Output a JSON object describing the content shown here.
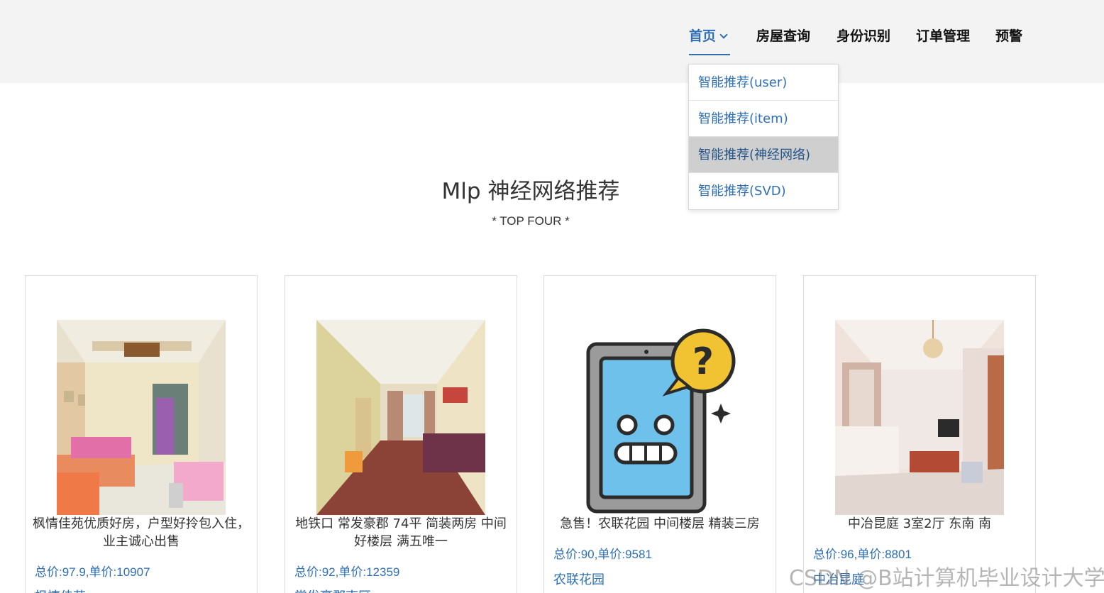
{
  "nav": {
    "items": [
      {
        "label": "首页",
        "active": true
      },
      {
        "label": "房屋查询"
      },
      {
        "label": "身份识别"
      },
      {
        "label": "订单管理"
      },
      {
        "label": "预警"
      }
    ],
    "dropdown": [
      {
        "label": "智能推荐(user)"
      },
      {
        "label": "智能推荐(item)"
      },
      {
        "label": "智能推荐(神经网络)",
        "hover": true
      },
      {
        "label": "智能推荐(SVD)"
      }
    ]
  },
  "section": {
    "title": "Mlp 神经网络推荐",
    "subtitle": "* TOP FOUR *"
  },
  "cards": [
    {
      "name": "枫情佳苑优质好房，户型好拎包入住，业主诚心出售",
      "price": "总价:97.9,单价:10907",
      "community": "枫情佳苑",
      "image": "living-room-photo"
    },
    {
      "name": "地铁口 常发豪郡 74平 简装两房 中间好楼层 满五唯一",
      "price": "总价:92,单价:12359",
      "community": "常发豪郡南区",
      "image": "living-room-photo"
    },
    {
      "name": "急售！农联花园 中间楼层 精装三房",
      "price": "总价:90,单价:9581",
      "community": "农联花园",
      "image": "missing-image-tablet-icon"
    },
    {
      "name": "中冶昆庭 3室2厅 东南 南",
      "price": "总价:96,单价:8801",
      "community": "中冶昆庭",
      "image": "living-room-photo"
    }
  ],
  "watermark": "CSDN @B站计算机毕业设计大学"
}
